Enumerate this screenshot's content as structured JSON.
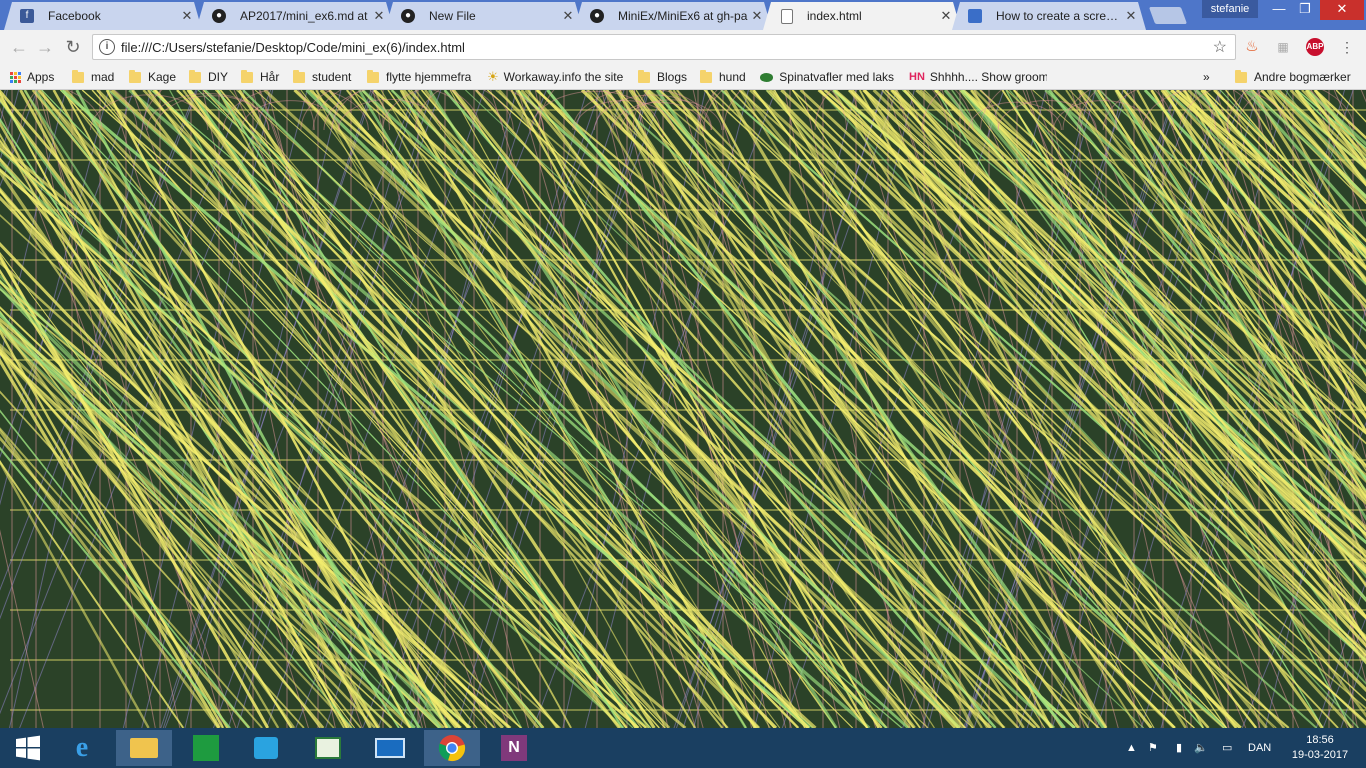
{
  "browser": {
    "tabs": [
      {
        "title": "Facebook",
        "icon": "facebook-icon",
        "active": false
      },
      {
        "title": "AP2017/mini_ex6.md at",
        "icon": "github-icon",
        "active": false
      },
      {
        "title": "New File",
        "icon": "github-icon",
        "active": false
      },
      {
        "title": "MiniEx/MiniEx6 at gh-pa",
        "icon": "github-icon",
        "active": false
      },
      {
        "title": "index.html",
        "icon": "file-icon",
        "active": true
      },
      {
        "title": "How to create a screens",
        "icon": "page-icon",
        "active": false
      }
    ],
    "user": "stefanie",
    "url": "file:///C:/Users/stefanie/Desktop/Code/mini_ex(6)/index.html",
    "extensions": [
      "fire-icon",
      "puzzle-icon",
      "adblock-icon",
      "menu-icon"
    ],
    "adblock_label": "ABP"
  },
  "bookmarks": {
    "apps_label": "Apps",
    "items": [
      {
        "label": "mad",
        "icon": "folder"
      },
      {
        "label": "Kage",
        "icon": "folder"
      },
      {
        "label": "DIY",
        "icon": "folder"
      },
      {
        "label": "Hår",
        "icon": "folder"
      },
      {
        "label": "student",
        "icon": "folder"
      },
      {
        "label": "flytte hjemmefra",
        "icon": "folder"
      },
      {
        "label": "Workaway.info the site",
        "icon": "sun"
      },
      {
        "label": "Blogs",
        "icon": "folder"
      },
      {
        "label": "hund",
        "icon": "folder"
      },
      {
        "label": "Spinatvafler med laks",
        "icon": "leaf"
      },
      {
        "label": "Shhhh.... Show groom",
        "icon": "hn"
      }
    ],
    "overflow": "»",
    "other_label": "Andre bogmærker"
  },
  "canvas": {
    "colors": {
      "background": "#2b4228",
      "yellow": "#f4ee6e",
      "pink": "#e89aa0",
      "purple": "#9a8ad8",
      "green": "#9ee27e"
    }
  },
  "taskbar": {
    "apps": [
      "windows-start-icon",
      "internet-explorer-icon",
      "file-explorer-icon",
      "windows-store-icon",
      "store-bag-icon",
      "reader-icon",
      "lenovo-icon",
      "chrome-icon",
      "onenote-icon"
    ],
    "language": "DAN",
    "time": "18:56",
    "date": "19-03-2017"
  }
}
